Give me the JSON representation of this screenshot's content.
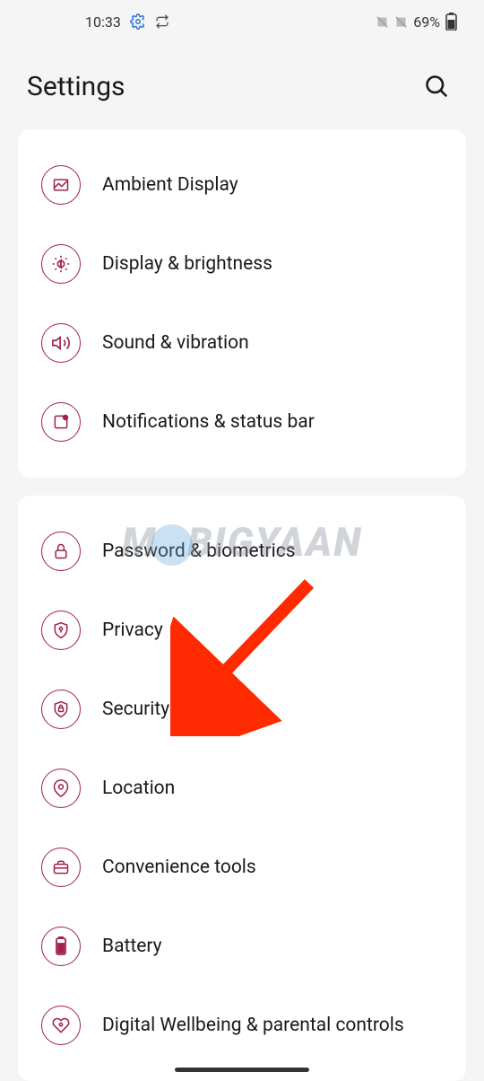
{
  "statusBar": {
    "time": "10:33",
    "battery": "69%"
  },
  "header": {
    "title": "Settings"
  },
  "group1": [
    {
      "label": "Ambient Display"
    },
    {
      "label": "Display & brightness"
    },
    {
      "label": "Sound & vibration"
    },
    {
      "label": "Notifications & status bar"
    }
  ],
  "group2": [
    {
      "label": "Password & biometrics"
    },
    {
      "label": "Privacy"
    },
    {
      "label": "Security"
    },
    {
      "label": "Location"
    },
    {
      "label": "Convenience tools"
    },
    {
      "label": "Battery"
    },
    {
      "label": "Digital Wellbeing & parental controls"
    }
  ],
  "watermark": "MOBIGYAAN",
  "accentColor": "#a1224a"
}
